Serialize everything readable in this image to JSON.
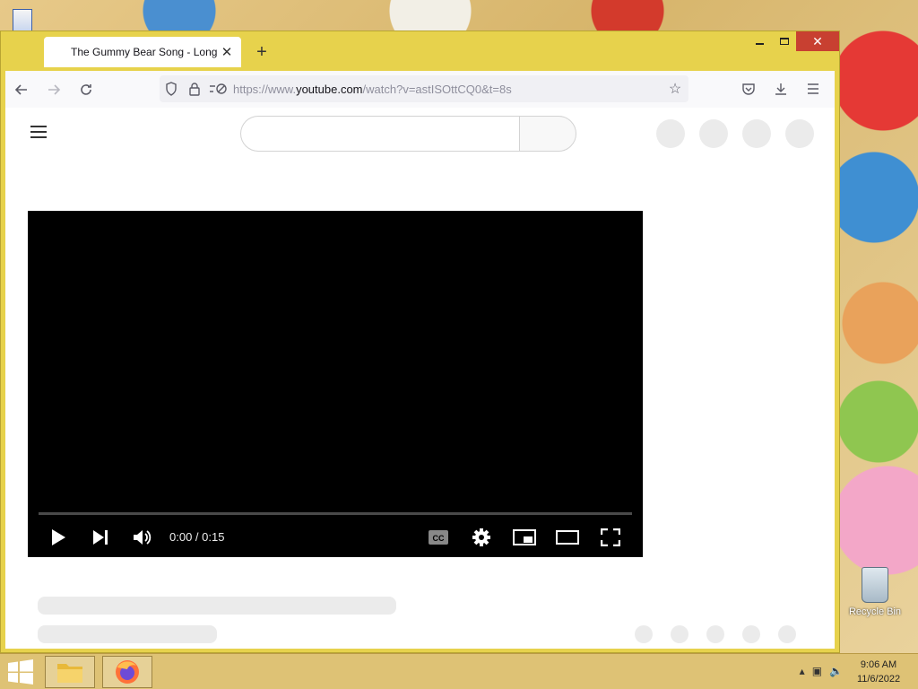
{
  "browser": {
    "tab": {
      "title": "The Gummy Bear Song - Long Version"
    },
    "url": {
      "prefix": "https://www.",
      "domain": "youtube.com",
      "path": "/watch?v=astISOttCQ0&t=8s"
    }
  },
  "player": {
    "time_label": "0:00 / 0:15",
    "progress": 0
  },
  "desktop": {
    "recycle_bin_label": "Recycle Bin"
  },
  "taskbar": {
    "time": "9:06 AM",
    "date": "11/6/2022"
  },
  "icons": {
    "tab_close": "close-icon",
    "new_tab": "plus-icon",
    "back": "arrow-left-icon",
    "forward": "arrow-right-icon",
    "reload": "reload-icon",
    "bookmark": "star-icon"
  }
}
